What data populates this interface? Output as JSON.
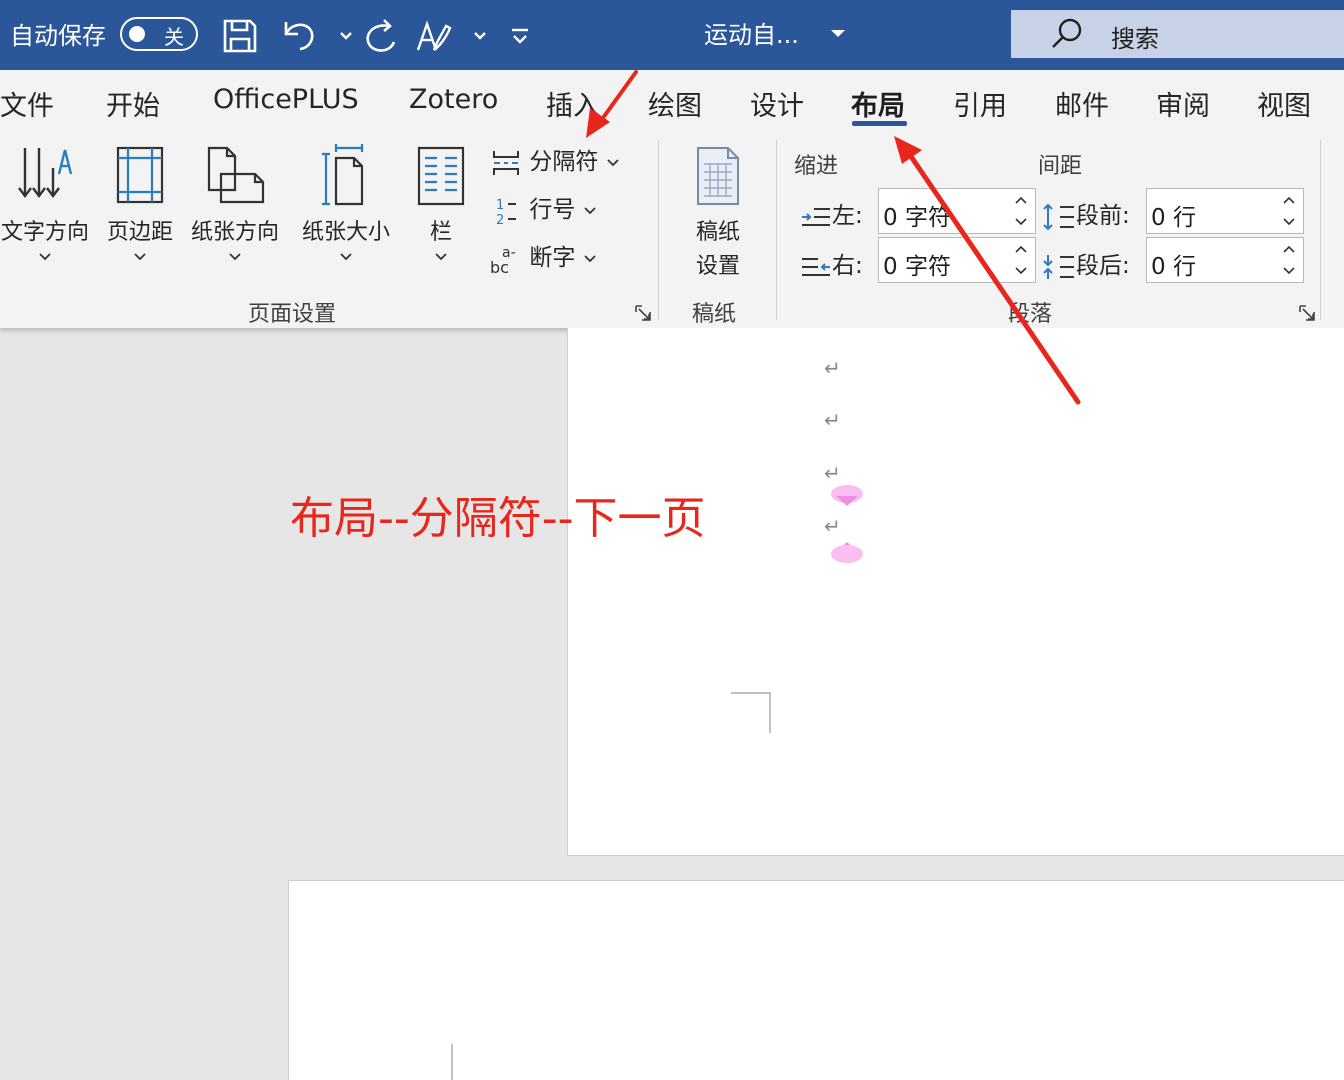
{
  "titlebar": {
    "autosave_label": "自动保存",
    "autosave_state": "关",
    "doc_title": "运动自...",
    "search_placeholder": "搜索"
  },
  "tabs": [
    {
      "label": "文件"
    },
    {
      "label": "开始"
    },
    {
      "label": "OfficePLUS"
    },
    {
      "label": "Zotero"
    },
    {
      "label": "插入"
    },
    {
      "label": "绘图"
    },
    {
      "label": "设计"
    },
    {
      "label": "布局",
      "active": true
    },
    {
      "label": "引用"
    },
    {
      "label": "邮件"
    },
    {
      "label": "审阅"
    },
    {
      "label": "视图"
    }
  ],
  "ribbon": {
    "page_setup": {
      "group_label": "页面设置",
      "text_direction": "文字方向",
      "margins": "页边距",
      "orientation": "纸张方向",
      "size": "纸张大小",
      "columns": "栏",
      "breaks": "分隔符",
      "line_numbers": "行号",
      "hyphenation": "断字"
    },
    "manuscript": {
      "group_label": "稿纸",
      "button_line1": "稿纸",
      "button_line2": "设置"
    },
    "paragraph": {
      "group_label": "段落",
      "indent_label": "缩进",
      "spacing_label": "间距",
      "left_label": "左:",
      "left_value": "0 字符",
      "right_label": "右:",
      "right_value": "0 字符",
      "before_label": "段前:",
      "before_value": "0 行",
      "after_label": "段后:",
      "after_value": "0 行"
    }
  },
  "document": {
    "paragraph_mark": "↵",
    "annotation": "布局--分隔符--下一页"
  },
  "colors": {
    "title_bar": "#2b579a",
    "annotation": "#e8261c",
    "arrow": "#e8261c"
  }
}
